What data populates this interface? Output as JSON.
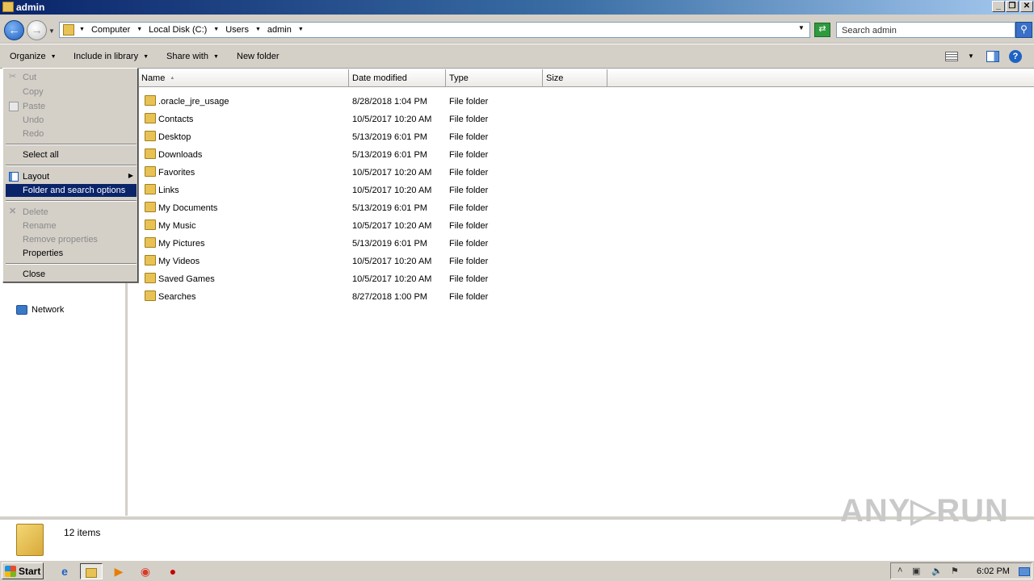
{
  "window": {
    "title": "admin"
  },
  "titlebar_buttons": {
    "minimize": "_",
    "restore": "❐",
    "close": "✕"
  },
  "address": {
    "crumbs": [
      "Computer",
      "Local Disk (C:)",
      "Users",
      "admin"
    ]
  },
  "search": {
    "placeholder": "Search admin"
  },
  "toolbar": {
    "organize": "Organize",
    "include_in_library": "Include in library",
    "share_with": "Share with",
    "new_folder": "New folder"
  },
  "columns": {
    "name": "Name",
    "date_modified": "Date modified",
    "type": "Type",
    "size": "Size"
  },
  "files": [
    {
      "name": ".oracle_jre_usage",
      "date": "8/28/2018 1:04 PM",
      "type": "File folder"
    },
    {
      "name": "Contacts",
      "date": "10/5/2017 10:20 AM",
      "type": "File folder"
    },
    {
      "name": "Desktop",
      "date": "5/13/2019 6:01 PM",
      "type": "File folder"
    },
    {
      "name": "Downloads",
      "date": "5/13/2019 6:01 PM",
      "type": "File folder"
    },
    {
      "name": "Favorites",
      "date": "10/5/2017 10:20 AM",
      "type": "File folder"
    },
    {
      "name": "Links",
      "date": "10/5/2017 10:20 AM",
      "type": "File folder"
    },
    {
      "name": "My Documents",
      "date": "5/13/2019 6:01 PM",
      "type": "File folder"
    },
    {
      "name": "My Music",
      "date": "10/5/2017 10:20 AM",
      "type": "File folder"
    },
    {
      "name": "My Pictures",
      "date": "5/13/2019 6:01 PM",
      "type": "File folder"
    },
    {
      "name": "My Videos",
      "date": "10/5/2017 10:20 AM",
      "type": "File folder"
    },
    {
      "name": "Saved Games",
      "date": "10/5/2017 10:20 AM",
      "type": "File folder"
    },
    {
      "name": "Searches",
      "date": "8/27/2018 1:00 PM",
      "type": "File folder"
    }
  ],
  "context_menu": {
    "cut": "Cut",
    "copy": "Copy",
    "paste": "Paste",
    "undo": "Undo",
    "redo": "Redo",
    "select_all": "Select all",
    "layout": "Layout",
    "folder_search_options": "Folder and search options",
    "delete": "Delete",
    "rename": "Rename",
    "remove_properties": "Remove properties",
    "properties": "Properties",
    "close": "Close"
  },
  "nav": {
    "network": "Network"
  },
  "status": {
    "item_count": "12 items"
  },
  "watermark": "ANY▷RUN",
  "taskbar": {
    "start": "Start",
    "clock": "6:02 PM"
  },
  "colors": {
    "selection": "#0a246a",
    "chrome": "#d4d0c8",
    "title_start": "#0a246a"
  }
}
